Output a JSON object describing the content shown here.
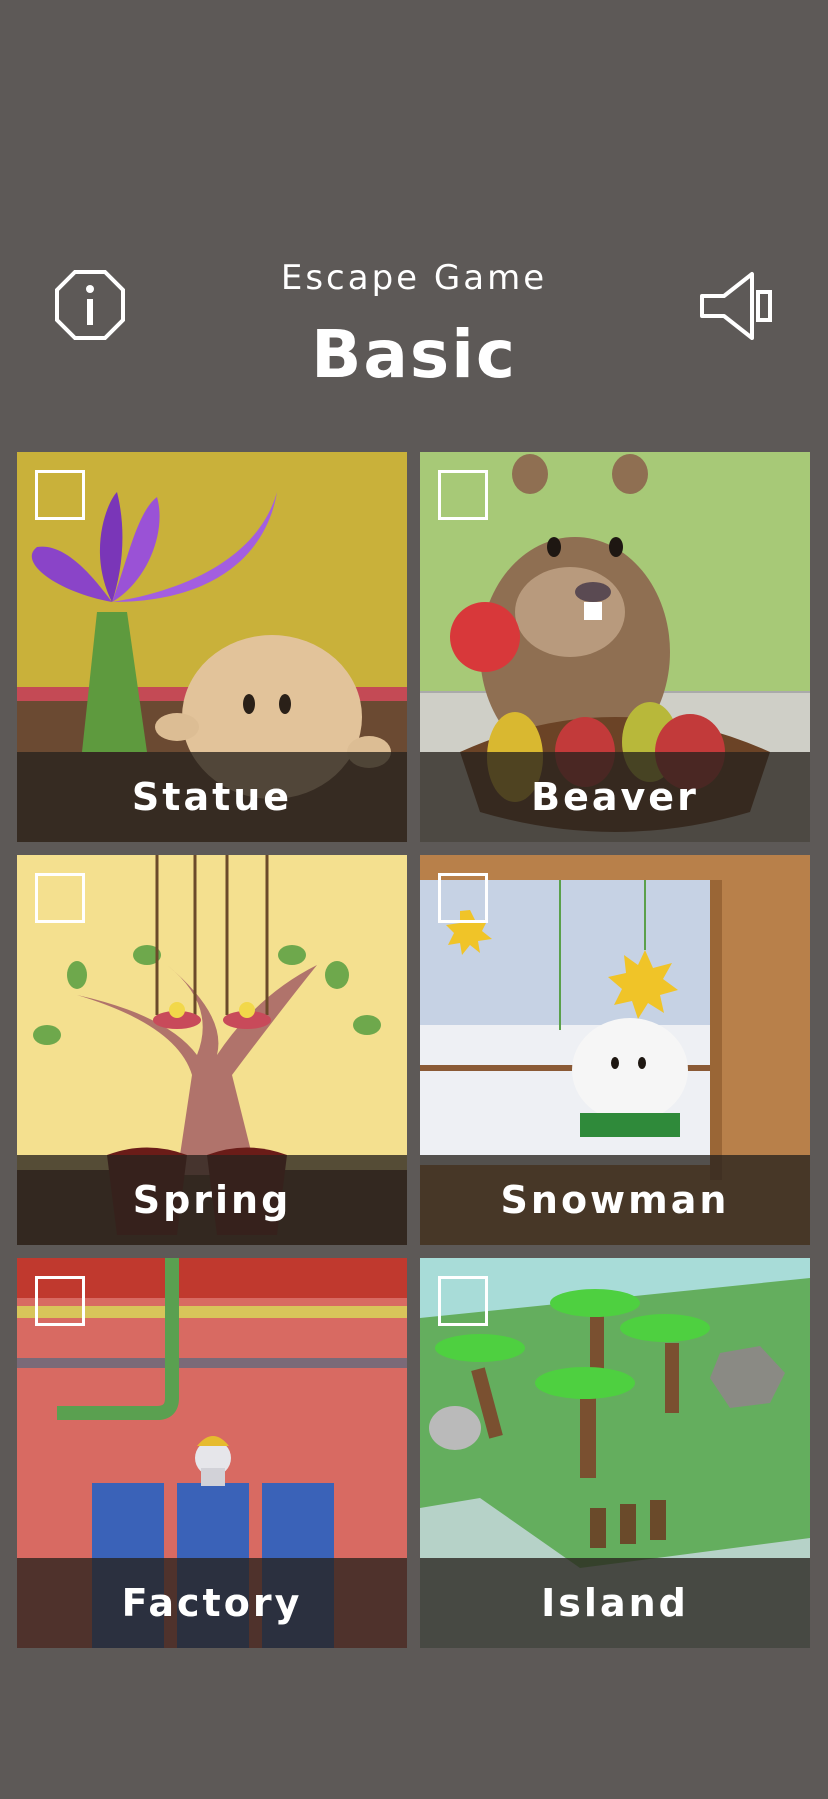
{
  "header": {
    "subtitle": "Escape Game",
    "title": "Basic",
    "info_icon": "info-icon",
    "sound_icon": "speaker-icon"
  },
  "levels": [
    {
      "label": "Statue",
      "completed": false
    },
    {
      "label": "Beaver",
      "completed": false
    },
    {
      "label": "Spring",
      "completed": false
    },
    {
      "label": "Snowman",
      "completed": false
    },
    {
      "label": "Factory",
      "completed": false
    },
    {
      "label": "Island",
      "completed": false
    }
  ],
  "colors": {
    "background": "#5d5957",
    "text": "#ffffff",
    "label_bar": "#28221e"
  }
}
